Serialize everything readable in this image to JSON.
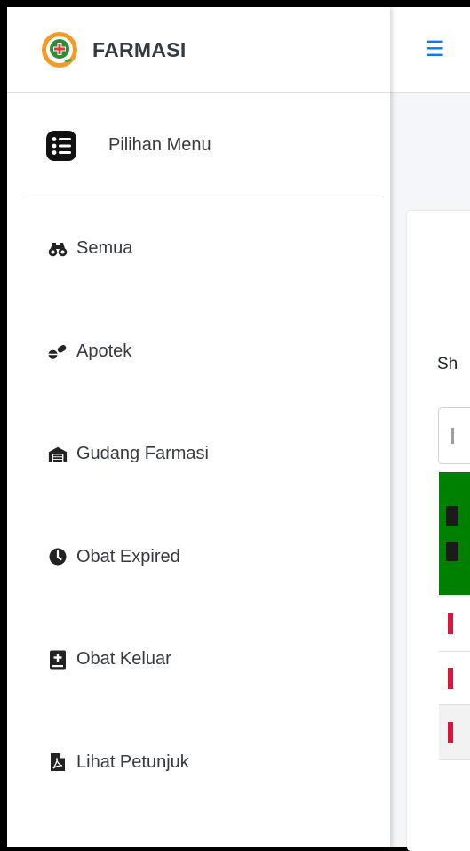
{
  "brand": {
    "name": "FARMASI",
    "logo": "pharmacy-plus-logo"
  },
  "sidebar": {
    "header": {
      "label": "Pilihan Menu",
      "icon": "list-icon"
    },
    "items": [
      {
        "label": "Semua",
        "icon": "binoculars-icon"
      },
      {
        "label": "Apotek",
        "icon": "pills-icon"
      },
      {
        "label": "Gudang Farmasi",
        "icon": "warehouse-icon"
      },
      {
        "label": "Obat Expired",
        "icon": "clock-icon"
      },
      {
        "label": "Obat Keluar",
        "icon": "medical-book-icon"
      },
      {
        "label": "Lihat Petunjuk",
        "icon": "pdf-file-icon"
      }
    ]
  },
  "topbar": {
    "menu_icon": "hamburger-icon",
    "accent": "#007bff"
  },
  "content": {
    "show_text": "Sh",
    "table_header_color": "#008000",
    "row_link_color": "#dc143c"
  }
}
